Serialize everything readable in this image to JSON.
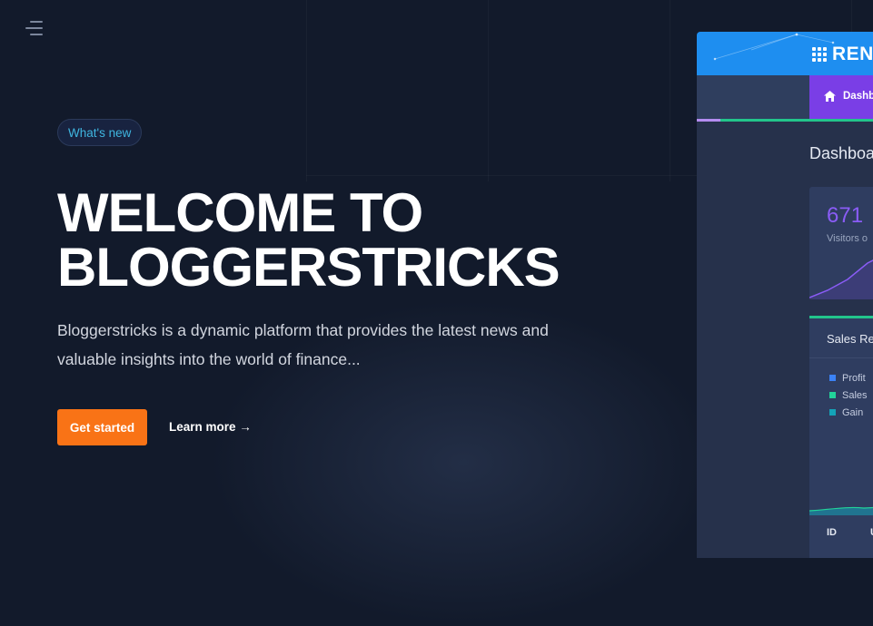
{
  "hero": {
    "badge": "What's new",
    "headline_line1": "WELCOME TO",
    "headline_line2": "BLOGGERSTRICKS",
    "description_line1": "Bloggerstricks is a dynamic platform that provides the latest news and",
    "description_line2": "valuable insights into the world of finance...",
    "cta_primary": "Get started",
    "cta_secondary": "Learn more →"
  },
  "preview": {
    "logo_text": "REN",
    "nav_tab": "Dashb",
    "title": "Dashboa",
    "stat_value": "671",
    "stat_label": "Visitors o",
    "sales_title": "Sales Re",
    "legend": [
      {
        "label": "Profit",
        "color": "#3b82f6"
      },
      {
        "label": "Sales",
        "color": "#22d39a"
      },
      {
        "label": "Gain",
        "color": "#14a3b8"
      }
    ],
    "table_headers": [
      "ID",
      "U"
    ]
  },
  "colors": {
    "background": "#121a2b",
    "accent_orange": "#f97316",
    "badge_text": "#3fb6e0",
    "preview_blue": "#1e8ef0",
    "preview_purple": "#7a3ee6"
  }
}
